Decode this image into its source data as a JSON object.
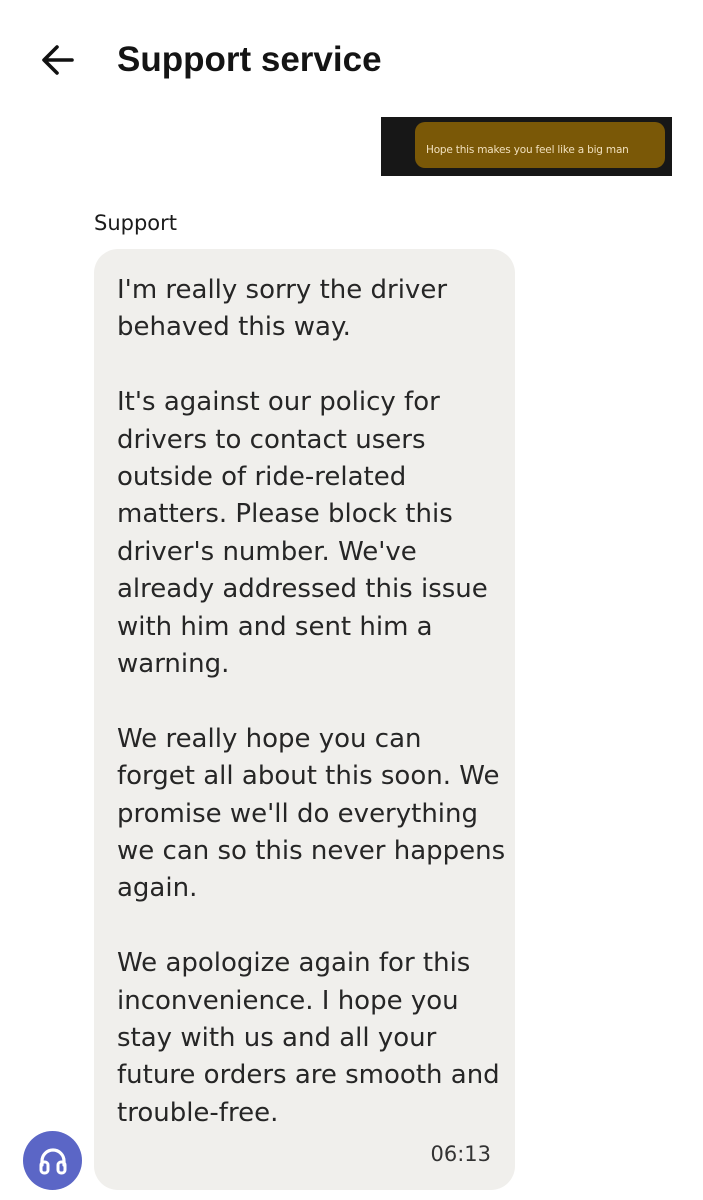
{
  "header": {
    "back_icon": "arrow-left-icon",
    "title": "Support service"
  },
  "attachment": {
    "text": "Hope this makes you feel like a big man",
    "bubble_color": "#7a5807",
    "background_color": "#171717"
  },
  "message": {
    "sender": "Support",
    "bubble_color": "#f0efec",
    "paragraphs": [
      "I'm really sorry the driver behaved this way.",
      "It's against our policy for drivers to contact users outside of ride-related matters. Please block this driver's number. We've already addressed this issue with him and sent him a warning.",
      "We really hope you can forget all about this soon. We promise we'll do everything we can so this never happens again.",
      "We apologize again for this inconvenience. I hope you stay with us and all your future orders are smooth and trouble-free."
    ],
    "time": "06:13"
  },
  "support_button": {
    "icon": "headphones-icon",
    "color": "#5b66c6"
  }
}
